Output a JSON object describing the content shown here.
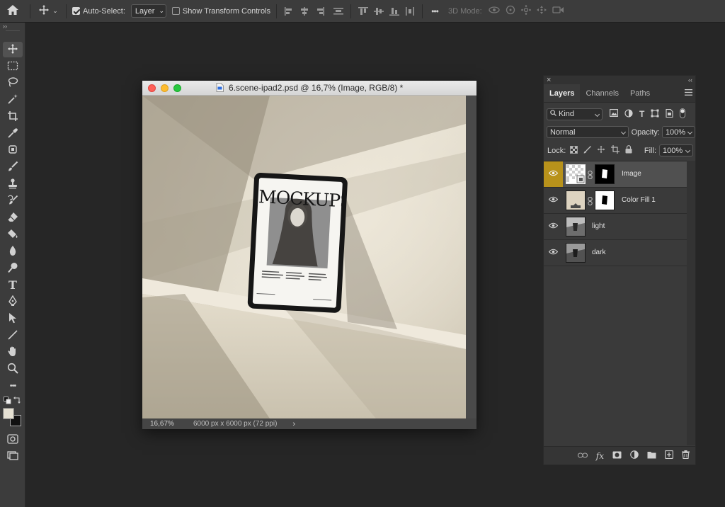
{
  "options_bar": {
    "auto_select_label": "Auto-Select:",
    "auto_select_checked": true,
    "auto_select_target": "Layer",
    "show_transform_label": "Show Transform Controls",
    "show_transform_checked": false,
    "more_label": "•••",
    "mode_3d_label": "3D Mode:"
  },
  "toolbar": {
    "collapse_glyph": "››",
    "tools": [
      "move",
      "marquee",
      "lasso",
      "magic-wand",
      "crop",
      "eyedropper",
      "healing",
      "brush",
      "clone-stamp",
      "history-brush",
      "eraser",
      "paint-bucket",
      "blur",
      "dodge",
      "type",
      "pen",
      "path-selection",
      "line",
      "hand",
      "zoom",
      "edit-toolbar",
      "swap-colors",
      "foreground-background",
      "quick-mask",
      "screen-mode"
    ],
    "type_glyph": "T",
    "more_glyph": "•••"
  },
  "document": {
    "title": "6.scene-ipad2.psd @ 16,7% (Image, RGB/8) *",
    "zoom": "16,67%",
    "dimensions": "6000 px x 6000 px (72 ppi)",
    "status_arrow": "›",
    "tablet_heading": "MOCKUPS",
    "colors": {
      "close": "#fe5f57",
      "minimize": "#febc2e",
      "maximize": "#28c840"
    }
  },
  "layers_panel": {
    "close_glyph": "×",
    "collapse_glyph": "‹‹",
    "tabs": [
      "Layers",
      "Channels",
      "Paths"
    ],
    "active_tab": "Layers",
    "filter_kind": "Kind",
    "blend_mode": "Normal",
    "opacity_label": "Opacity:",
    "opacity_value": "100%",
    "lock_label": "Lock:",
    "fill_label": "Fill:",
    "fill_value": "100%",
    "layers": [
      {
        "name": "Image",
        "visible": true,
        "selected": true
      },
      {
        "name": "Color Fill 1",
        "visible": true,
        "selected": false
      },
      {
        "name": "light",
        "visible": true,
        "selected": false
      },
      {
        "name": "dark",
        "visible": true,
        "selected": false
      }
    ],
    "footer_fx": "fx"
  }
}
